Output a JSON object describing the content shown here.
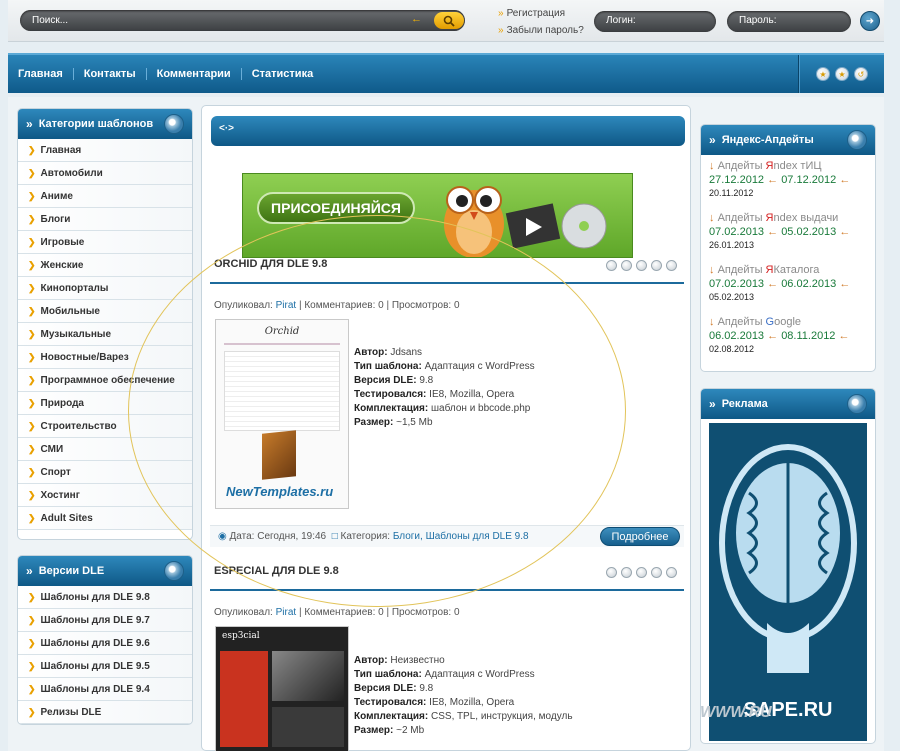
{
  "top": {
    "search_placeholder": "Поиск...",
    "register_label": "Регистрация",
    "forgot_label": "Забыли пароль?",
    "login_label": "Логин:",
    "password_label": "Пароль:"
  },
  "nav": {
    "items": [
      "Главная",
      "Контакты",
      "Комментарии",
      "Статистика"
    ]
  },
  "categories": {
    "title": "Категории шаблонов",
    "items": [
      "Главная",
      "Автомобили",
      "Аниме",
      "Блоги",
      "Игровые",
      "Женские",
      "Кинопорталы",
      "Мобильные",
      "Музыкальные",
      "Новостные/Варез",
      "Программное обеспечение",
      "Природа",
      "Строительство",
      "СМИ",
      "Спорт",
      "Хостинг",
      "Adult Sites"
    ]
  },
  "versions": {
    "title": "Версии DLE",
    "items": [
      "Шаблоны для DLE 9.8",
      "Шаблоны для DLE 9.7",
      "Шаблоны для DLE 9.6",
      "Шаблоны для DLE 9.5",
      "Шаблоны для DLE 9.4",
      "Релизы DLE"
    ]
  },
  "yandex": {
    "title": "Яндекс-Апдейты",
    "rows": [
      {
        "pre": "Апдейты ",
        "ya": "Я",
        "post": "ndex тИЦ",
        "d1": "27.12.2012",
        "d2": "07.12.2012",
        "small": "20.11.2012"
      },
      {
        "pre": "Апдейты ",
        "ya": "Я",
        "post": "ndex выдачи",
        "d1": "07.02.2013",
        "d2": "05.02.2013",
        "small": "26.01.2013"
      },
      {
        "pre": "Апдейты ",
        "ya": "Я",
        "post": "Каталога",
        "d1": "07.02.2013",
        "d2": "06.02.2013",
        "small": "05.02.2013"
      },
      {
        "pre": "Апдейты ",
        "ya": "G",
        "post": "oogle",
        "d1": "06.02.2013",
        "d2": "08.11.2012",
        "small": "02.08.2012"
      }
    ]
  },
  "ad": {
    "title": "Реклама",
    "logo_text": "SAPE.RU"
  },
  "pagebar": {
    "code_label": "<·>"
  },
  "banner": {
    "join_label": "ПРИСОЕДИНЯЙСЯ"
  },
  "posts": [
    {
      "title": "ORCHID ДЛЯ DLE 9.8",
      "meta_pre": "Опуликовал: ",
      "author": "Pirat",
      "meta_post": " | Комментариев: 0 | Просмотров: 0",
      "thumb_title": "Orchid",
      "thumb_logo": "NewTemplates.ru",
      "specs": [
        {
          "k": "Автор:",
          "v": "Jdsans"
        },
        {
          "k": "Тип шаблона:",
          "v": "Адаптация с WordPress"
        },
        {
          "k": "Версия DLE:",
          "v": "9.8"
        },
        {
          "k": "Тестировался:",
          "v": "IE8, Mozilla, Opera"
        },
        {
          "k": "Комплектация:",
          "v": "шаблон и bbcode.php"
        },
        {
          "k": "Размер:",
          "v": "~1,5 Mb"
        }
      ],
      "date": "Дата: Сегодня, 19:46",
      "cat_pre": "Категория: ",
      "cats": "Блоги, Шаблоны для DLE 9.8",
      "more_label": "Подробнее"
    },
    {
      "title": "ESPECIAL ДЛЯ DLE 9.8",
      "meta_pre": "Опуликовал: ",
      "author": "Pirat",
      "meta_post": " | Комментариев: 0 | Просмотров: 0",
      "thumb_title": "esp3cial",
      "specs": [
        {
          "k": "Автор:",
          "v": "Неизвестно"
        },
        {
          "k": "Тип шаблона:",
          "v": "Адаптация с WordPress"
        },
        {
          "k": "Версия DLE:",
          "v": "9.8"
        },
        {
          "k": "Тестировался:",
          "v": "IE8, Mozilla, Opera"
        },
        {
          "k": "Комплектация:",
          "v": "CSS, TPL, инструкция, модуль"
        },
        {
          "k": "Размер:",
          "v": "~2 Mb"
        }
      ]
    }
  ],
  "watermark": "WWW.RU"
}
